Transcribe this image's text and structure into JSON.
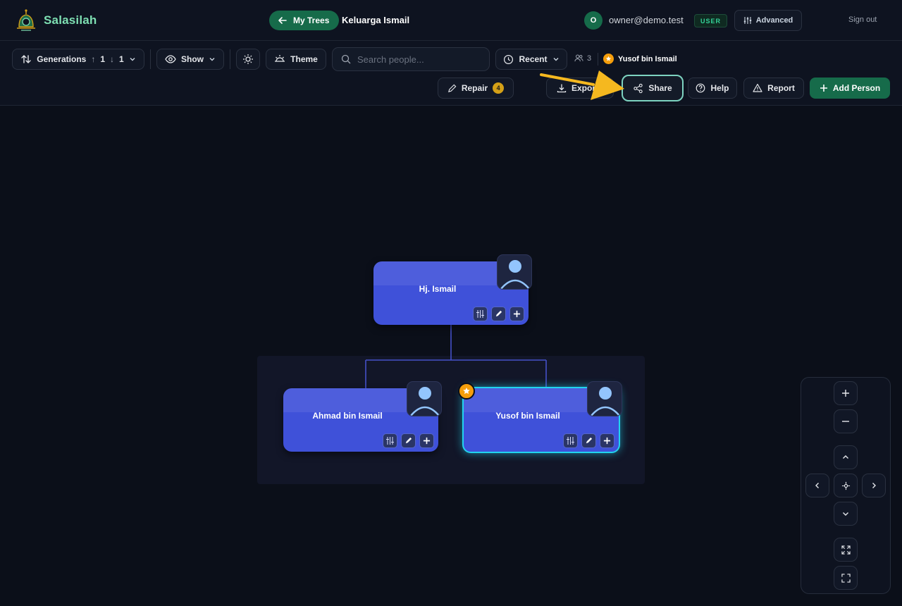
{
  "app": {
    "name": "Salasilah"
  },
  "header": {
    "back_label": "My Trees",
    "tree_name": "Keluarga Ismail",
    "user_initial": "O",
    "user_email": "owner@demo.test",
    "role": "USER",
    "advanced_label": "Advanced",
    "signout_label": "Sign out"
  },
  "toolbar": {
    "generations_label": "Generations",
    "gen_up": "1",
    "gen_down": "1",
    "show_label": "Show",
    "theme_label": "Theme",
    "search_placeholder": "Search people...",
    "recent_label": "Recent",
    "people_count": "3",
    "focus_person": "Yusof bin Ismail",
    "repair_label": "Repair",
    "repair_count": "4",
    "export_label": "Expor",
    "share_label": "Share",
    "help_label": "Help",
    "report_label": "Report",
    "add_person_label": "Add Person"
  },
  "tree": {
    "root": {
      "name": "Hj. Ismail"
    },
    "children": [
      {
        "name": "Ahmad bin Ismail",
        "selected": false
      },
      {
        "name": "Yusof bin Ismail",
        "selected": true,
        "starred": true
      }
    ]
  },
  "colors": {
    "accent": "#166b4a",
    "card": "#3f51d9",
    "selected_outline": "#22d3ee",
    "star": "#f59e0b",
    "highlight_arrow": "#f5b81f"
  }
}
